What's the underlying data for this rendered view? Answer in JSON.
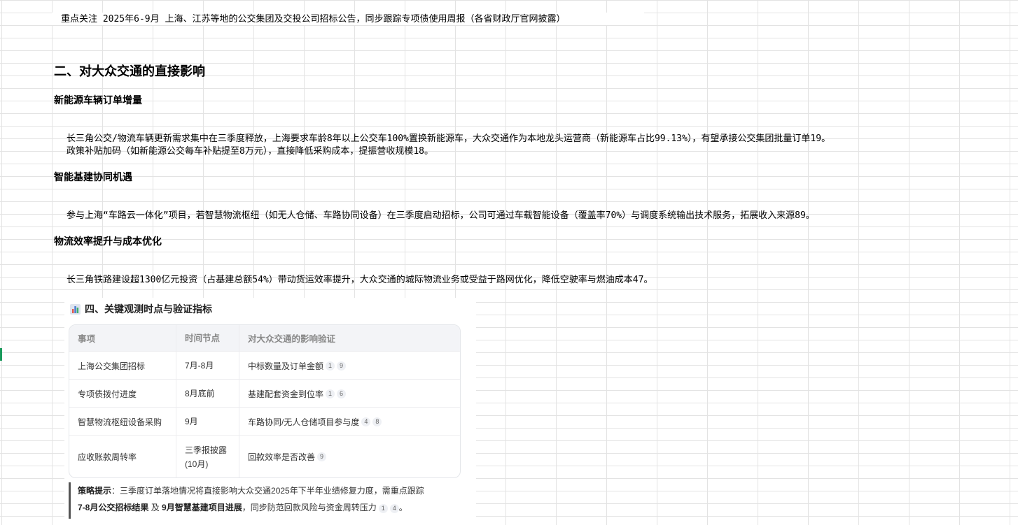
{
  "sheet": {
    "note_line": "重点关注 2025年6-9月 上海、江苏等地的公交集团及交投公司招标公告，同步跟踪专项债使用周报（各省财政厅官网披露）"
  },
  "section2": {
    "heading": "二、对大众交通的直接影响",
    "sub1": {
      "title": "新能源车辆订单增量",
      "line1": "长三角公交/物流车辆更新需求集中在三季度释放，上海要求车龄8年以上公交车100%置换新能源车，大众交通作为本地龙头运营商（新能源车占比99.13%），有望承接公交集团批量订单19。",
      "line2": "政策补贴加码（如新能源公交每车补贴提至8万元），直接降低采购成本，提振营收规模18。"
    },
    "sub2": {
      "title": "智能基建协同机遇",
      "line1": "参与上海“车路云一体化”项目，若智慧物流枢纽（如无人仓储、车路协同设备）在三季度启动招标，公司可通过车载智能设备（覆盖率70%）与调度系统输出技术服务，拓展收入来源89。"
    },
    "sub3": {
      "title": "物流效率提升与成本优化",
      "line1": "长三角铁路建设超1300亿元投资（占基建总额54%）带动货运效率提升，大众交通的城际物流业务或受益于路网优化，降低空驶率与燃油成本47。"
    }
  },
  "card": {
    "title": "四、关键观测时点与验证指标",
    "icon": "bar-chart-icon",
    "headers": [
      "事项",
      "时间节点",
      "对大众交通的影响验证"
    ],
    "rows": [
      {
        "item": "上海公交集团招标",
        "time": "7月-8月",
        "impact": "中标数量及订单金额",
        "refs": [
          "1",
          "9"
        ]
      },
      {
        "item": "专项债拨付进度",
        "time": "8月底前",
        "impact": "基建配套资金到位率",
        "refs": [
          "1",
          "6"
        ]
      },
      {
        "item": "智慧物流枢纽设备采购",
        "time": "9月",
        "impact": "车路协同/无人仓储项目参与度",
        "refs": [
          "4",
          "8"
        ]
      },
      {
        "item": "应收账款周转率",
        "time": "三季报披露(10月)",
        "time_line1": "三季报披露",
        "time_line2": "(10月)",
        "impact": "回款效率是否改善",
        "refs": [
          "9"
        ]
      }
    ],
    "tip": {
      "label": "策略提示",
      "colon": "：",
      "text1": "三季度订单落地情况将直接影响大众交通2025年下半年业绩修复力度，需重点跟踪",
      "bold1": "7-8月公交招标结果",
      "mid": " 及 ",
      "bold2": "9月智慧基建项目进展",
      "text2": "，同步防范回款风险与资金周转压力",
      "refs": [
        "1",
        "4"
      ],
      "end": "。"
    }
  },
  "colors": {
    "grid_line": "#e3e3e3",
    "active_row_marker": "#1a9a5c",
    "table_header_bg": "#f3f4f7"
  }
}
